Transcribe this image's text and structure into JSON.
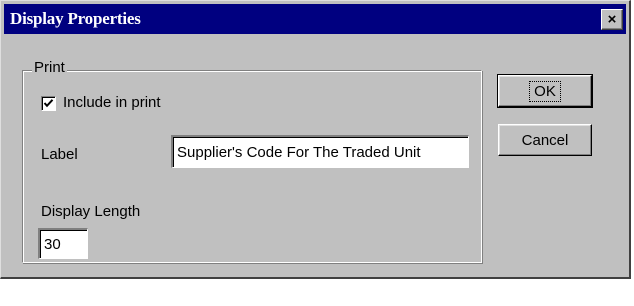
{
  "window": {
    "title": "Display Properties",
    "close_glyph": "×"
  },
  "print_group": {
    "legend": "Print",
    "include_checkbox": {
      "label": "Include in print",
      "checked": true
    },
    "label_field": {
      "label": "Label",
      "value": "Supplier's Code For The Traded Unit"
    },
    "display_length_field": {
      "label": "Display Length",
      "value": "30"
    }
  },
  "buttons": {
    "ok_label": "OK",
    "cancel_label": "Cancel"
  },
  "colors": {
    "titlebar": "#000080",
    "face": "#c0c0c0"
  }
}
